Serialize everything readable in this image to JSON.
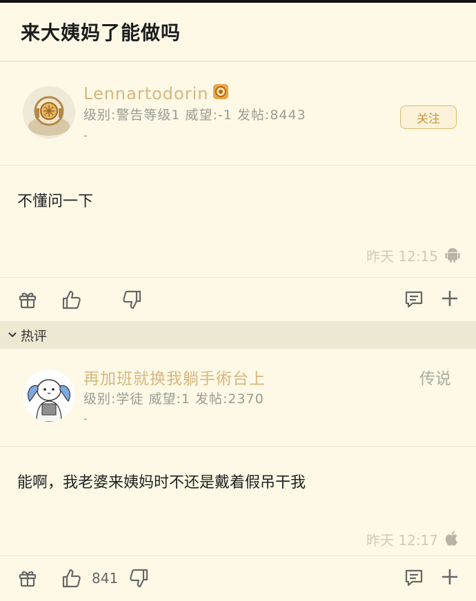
{
  "page": {
    "title": "来大姨妈了能做吗"
  },
  "post": {
    "username": "Lennartodorin",
    "meta": "级别:警告等级1 威望:-1 发帖:8443",
    "dash": "-",
    "follow_label": "关注",
    "content": "不懂问一下",
    "timestamp": "昨天 12:15",
    "platform_icon": "android-icon"
  },
  "section": {
    "label": "热评"
  },
  "reply": {
    "username": "再加班就换我躺手術台上",
    "level": "传说",
    "meta": "级别:学徒 威望:1 发帖:2370",
    "dash": "-",
    "content": "能啊，我老婆来姨妈时不还是戴着假吊干我",
    "timestamp": "昨天 12:17",
    "platform_icon": "apple-icon",
    "like_count": "841"
  },
  "colors": {
    "background": "#fdf9e6",
    "username": "#d7b77e",
    "accent": "#d9b86f",
    "section_bg": "#ede8d2"
  }
}
